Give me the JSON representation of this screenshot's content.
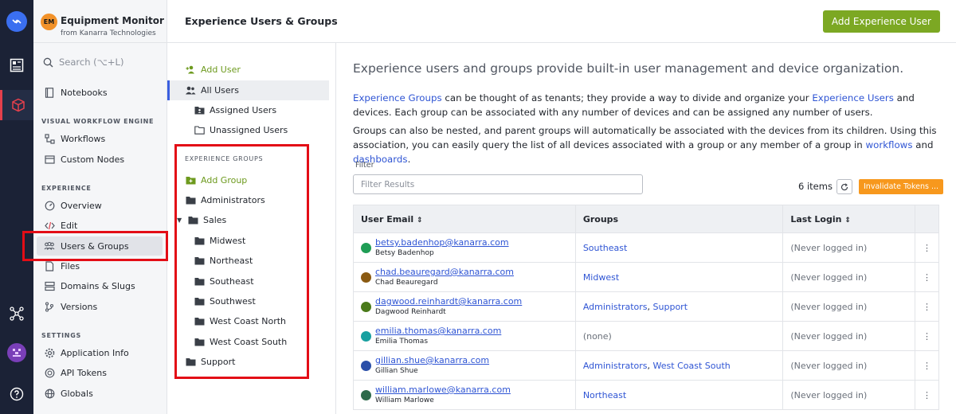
{
  "app": {
    "avatar": "EM",
    "name": "Equipment Monitor",
    "org": "from Kanarra Technologies"
  },
  "search": {
    "placeholder": "Search (⌥+L)"
  },
  "sidebar": {
    "top_item": "Notebooks",
    "sections": [
      {
        "title": "VISUAL WORKFLOW ENGINE",
        "items": [
          "Workflows",
          "Custom Nodes"
        ]
      },
      {
        "title": "EXPERIENCE",
        "items": [
          "Overview",
          "Edit",
          "Users & Groups",
          "Files",
          "Domains & Slugs",
          "Versions"
        ]
      },
      {
        "title": "SETTINGS",
        "items": [
          "Application Info",
          "API Tokens",
          "Globals"
        ]
      }
    ]
  },
  "header": {
    "title": "Experience Users & Groups",
    "add_button": "Add Experience User"
  },
  "groups_panel": {
    "add_user": "Add User",
    "all_users": "All Users",
    "assigned_users": "Assigned Users",
    "unassigned_users": "Unassigned Users",
    "section_title": "EXPERIENCE GROUPS",
    "add_group": "Add Group",
    "groups": [
      "Administrators",
      "Sales",
      "Midwest",
      "Northeast",
      "Southeast",
      "Southwest",
      "West Coast North",
      "West Coast South",
      "Support"
    ]
  },
  "main": {
    "headline": "Experience users and groups provide built-in user management and device organization.",
    "p1": {
      "link1": "Experience Groups",
      "text1": " can be thought of as tenants; they provide a way to divide and organize your ",
      "link2": "Experience Users",
      "text2": " and devices. Each group can be associated with any number of devices and can be assigned any number of users."
    },
    "p2": {
      "text1": "Groups can also be nested, and parent groups will automatically be associated with the devices from its children. Using this association, you can easily query the list of all devices associated with a group or any member of a group in ",
      "link1": "workflows",
      "text2": " and ",
      "link2": "dashboards",
      "text3": "."
    },
    "filter_label": "Filter",
    "filter_placeholder": "Filter Results",
    "count": "6 items",
    "invalidate": "Invalidate Tokens ..."
  },
  "table": {
    "columns": [
      "User Email",
      "Groups",
      "Last Login"
    ],
    "rows": [
      {
        "email": "betsy.badenhop@kanarra.com",
        "name": "Betsy Badenhop",
        "groups": [
          "Southeast"
        ],
        "last_login": "(Never logged in)",
        "avatar_color": "#1f9d55"
      },
      {
        "email": "chad.beauregard@kanarra.com",
        "name": "Chad Beauregard",
        "groups": [
          "Midwest"
        ],
        "last_login": "(Never logged in)",
        "avatar_color": "#8a5a12"
      },
      {
        "email": "dagwood.reinhardt@kanarra.com",
        "name": "Dagwood Reinhardt",
        "groups": [
          "Administrators",
          "Support"
        ],
        "last_login": "(Never logged in)",
        "avatar_color": "#4a7a1a"
      },
      {
        "email": "emilia.thomas@kanarra.com",
        "name": "Emilia Thomas",
        "groups": [],
        "groups_none": "(none)",
        "last_login": "(Never logged in)",
        "avatar_color": "#18a0a0"
      },
      {
        "email": "gillian.shue@kanarra.com",
        "name": "Gillian Shue",
        "groups": [
          "Administrators",
          "West Coast South"
        ],
        "last_login": "(Never logged in)",
        "avatar_color": "#2a4fa8"
      },
      {
        "email": "william.marlowe@kanarra.com",
        "name": "William Marlowe",
        "groups": [
          "Northeast"
        ],
        "last_login": "(Never logged in)",
        "avatar_color": "#2d6a4a"
      }
    ]
  },
  "colors": {
    "accent_green": "#7ca823",
    "link_blue": "#2f55d4",
    "warning_orange": "#f7981d",
    "highlight_red": "#e30d16"
  }
}
